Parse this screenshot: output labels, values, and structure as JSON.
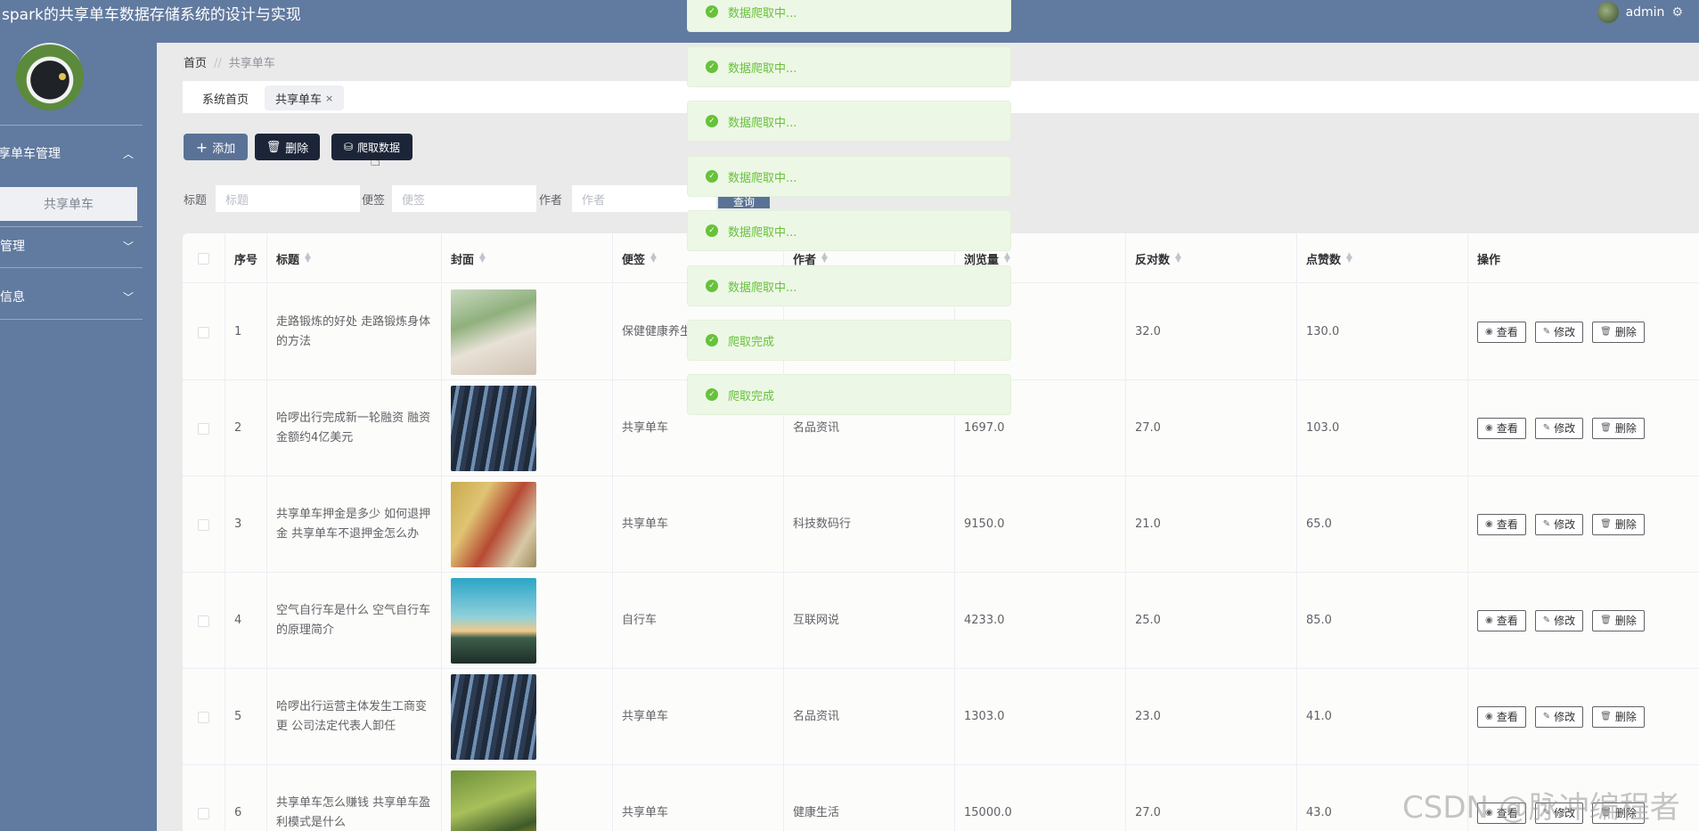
{
  "header": {
    "title": "spark的共享单车数据存储系统的设计与实现",
    "username": "admin"
  },
  "sidebar": {
    "items": [
      {
        "label": "共享单车管理",
        "arrow": "︿",
        "expanded": true
      },
      {
        "label": "系统管理",
        "arrow": "﹀",
        "expanded": false
      },
      {
        "label": "个人信息",
        "arrow": "﹀",
        "expanded": false
      }
    ],
    "subitem": "共享单车"
  },
  "breadcrumb": {
    "home": "首页",
    "sep": "//",
    "current": "共享单车"
  },
  "tabs": [
    {
      "label": "系统首页"
    },
    {
      "label": "共享单车",
      "close": "×"
    }
  ],
  "toolbar": {
    "add": "添加",
    "delete": "删除",
    "crawl": "爬取数据"
  },
  "search": {
    "title_label": "标题",
    "title_placeholder": "标题",
    "note_label": "便签",
    "note_placeholder": "便签",
    "author_label": "作者",
    "author_placeholder": "作者",
    "query": "查询"
  },
  "table": {
    "headers": [
      "序号",
      "标题",
      "封面",
      "便签",
      "作者",
      "浏览量",
      "反对数",
      "点赞数",
      "操作"
    ],
    "rows": [
      {
        "index": "1",
        "title": "走路锻炼的好处 走路锻炼身体的方法",
        "cover": "park-couple",
        "note": "保健健康养生",
        "author": "",
        "views": "",
        "dislikes": "32.0",
        "likes": "130.0"
      },
      {
        "index": "2",
        "title": "哈啰出行完成新一轮融资 融资金额约4亿美元",
        "cover": "bike-row",
        "note": "共享单车",
        "author": "名品资讯",
        "views": "1697.0",
        "dislikes": "27.0",
        "likes": "103.0"
      },
      {
        "index": "3",
        "title": "共享单车押金是多少 如何退押金 共享单车不退押金怎么办",
        "cover": "autumn-bikes",
        "note": "共享单车",
        "author": "科技数码行",
        "views": "9150.0",
        "dislikes": "21.0",
        "likes": "65.0"
      },
      {
        "index": "4",
        "title": "空气自行车是什么 空气自行车的原理简介",
        "cover": "sunset-bike",
        "note": "自行车",
        "author": "互联网说",
        "views": "4233.0",
        "dislikes": "25.0",
        "likes": "85.0"
      },
      {
        "index": "5",
        "title": "哈啰出行运营主体发生工商变更 公司法定代表人卸任",
        "cover": "bike-row",
        "note": "共享单车",
        "author": "名品资讯",
        "views": "1303.0",
        "dislikes": "23.0",
        "likes": "41.0"
      },
      {
        "index": "6",
        "title": "共享单车怎么赚钱 共享单车盈利模式是什么",
        "cover": "yellow-bike",
        "note": "共享单车",
        "author": "健康生活",
        "views": "15000.0",
        "dislikes": "27.0",
        "likes": "43.0"
      }
    ],
    "ops": {
      "view": "查看",
      "edit": "修改",
      "delete": "删除"
    }
  },
  "toasts": [
    "数据爬取中...",
    "数据爬取中...",
    "数据爬取中...",
    "数据爬取中...",
    "数据爬取中...",
    "数据爬取中...",
    "爬取完成",
    "爬取完成"
  ],
  "watermark": "CSDN @脉冲编程者",
  "colors": {
    "header": "#617a9f",
    "dark_button": "#1c2538",
    "success": "#67c23a"
  }
}
